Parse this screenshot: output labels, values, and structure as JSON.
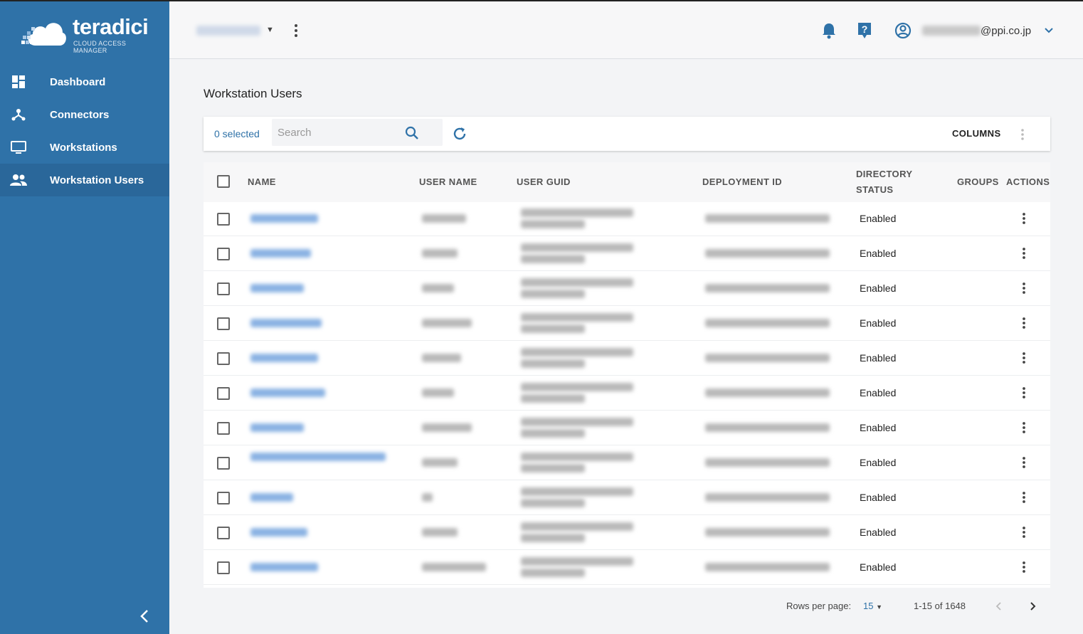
{
  "brand": {
    "name": "teradici",
    "product": "CLOUD ACCESS MANAGER"
  },
  "sidebar": {
    "items": [
      {
        "label": "Dashboard",
        "icon": "dashboard-icon"
      },
      {
        "label": "Connectors",
        "icon": "connectors-icon"
      },
      {
        "label": "Workstations",
        "icon": "monitor-icon"
      },
      {
        "label": "Workstation Users",
        "icon": "users-icon",
        "active": true
      }
    ]
  },
  "topbar": {
    "user_email_domain": "@ppi.co.jp",
    "icons": [
      "bell-icon",
      "help-icon",
      "account-icon"
    ]
  },
  "page": {
    "title": "Workstation Users"
  },
  "toolbar": {
    "selected_label": "0 selected",
    "search_placeholder": "Search",
    "columns_label": "COLUMNS"
  },
  "table": {
    "headers": {
      "name": "NAME",
      "user_name": "USER NAME",
      "user_guid": "USER GUID",
      "deployment_id": "DEPLOYMENT ID",
      "directory_status_1": "DIRECTORY",
      "directory_status_2": "STATUS",
      "groups": "GROUPS",
      "actions": "ACTIONS"
    },
    "rows": [
      {
        "status": "Enabled"
      },
      {
        "status": "Enabled"
      },
      {
        "status": "Enabled"
      },
      {
        "status": "Enabled"
      },
      {
        "status": "Enabled"
      },
      {
        "status": "Enabled"
      },
      {
        "status": "Enabled"
      },
      {
        "status": "Enabled"
      },
      {
        "status": "Enabled"
      },
      {
        "status": "Enabled"
      },
      {
        "status": "Enabled"
      }
    ]
  },
  "pagination": {
    "rows_per_page_label": "Rows per page:",
    "rows_per_page": "15",
    "range": "1-15 of 1648"
  },
  "colors": {
    "sidebar_bg": "#2f72a8",
    "sidebar_active": "#2a679a",
    "accent": "#2f72a8"
  }
}
